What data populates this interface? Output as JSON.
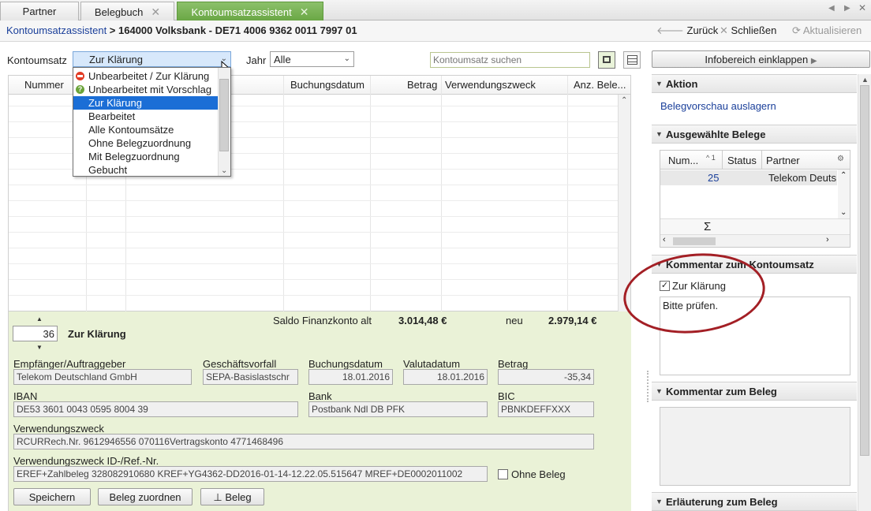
{
  "tabs": [
    {
      "label": "Partner"
    },
    {
      "label": "Belegbuch"
    },
    {
      "label": "Kontoumsatzassistent"
    }
  ],
  "breadcrumb": {
    "link": "Kontoumsatzassistent",
    "rest": " > 164000 Volksbank - DE71 4006 9362 0011 7997 01"
  },
  "toolbar": {
    "back": "Zurück",
    "close": "Schließen",
    "refresh": "Aktualisieren"
  },
  "filters": {
    "kontoumsatz_label": "Kontoumsatz",
    "kontoumsatz_value": "Zur Klärung",
    "jahr_label": "Jahr",
    "jahr_value": "Alle",
    "search_placeholder": "Kontoumsatz suchen",
    "infobereich": "Infobereich einklappen"
  },
  "dropdown_options": [
    "Unbearbeitet / Zur Klärung",
    "Unbearbeitet mit Vorschlag",
    "Zur Klärung",
    "Bearbeitet",
    "Alle Kontoumsätze",
    "Ohne Belegzuordnung",
    "Mit Belegzuordnung",
    "Gebucht"
  ],
  "grid": {
    "columns": [
      "Nummer",
      "Buchungsdatum",
      "Betrag",
      "Verwendungszweck",
      "Anz. Bele..."
    ]
  },
  "detail": {
    "saldo_label": "Saldo Finanzkonto alt",
    "saldo_alt": "3.014,48 €",
    "neu_label": "neu",
    "saldo_neu": "2.979,14 €",
    "number": "36",
    "status": "Zur Klärung",
    "empfaenger_label": "Empfänger/Auftraggeber",
    "empfaenger": "Telekom Deutschland GmbH",
    "geschaeftsvorfall_label": "Geschäftsvorfall",
    "geschaeftsvorfall": "SEPA-Basislastschr",
    "buchungsdatum_label": "Buchungsdatum",
    "buchungsdatum": "18.01.2016",
    "valutadatum_label": "Valutadatum",
    "valutadatum": "18.01.2016",
    "betrag_label": "Betrag",
    "betrag": "-35,34",
    "iban_label": "IBAN",
    "iban": "DE53 3601 0043 0595 8004 39",
    "bank_label": "Bank",
    "bank": "Postbank Ndl DB PFK",
    "bic_label": "BIC",
    "bic": "PBNKDEFFXXX",
    "vz_label": "Verwendungszweck",
    "vz": "RCURRech.Nr. 9612946556 070116Vertragskonto 4771468496",
    "vzid_label": "Verwendungszweck ID-/Ref.-Nr.",
    "vzid": "EREF+Zahlbeleg 328082910680 KREF+YG4362-DD2016-01-14-12.22.05.515647 MREF+DE0002011002",
    "ohne_beleg": "Ohne Beleg",
    "save": "Speichern",
    "assign": "Beleg zuordnen",
    "beleg": "Beleg"
  },
  "right": {
    "aktion_title": "Aktion",
    "belegvorschau": "Belegvorschau auslagern",
    "ausgewaehlte_title": "Ausgewählte Belege",
    "col_num": "Num...",
    "col_sort": "^ 1",
    "col_status": "Status",
    "col_partner": "Partner",
    "row_num": "25",
    "row_partner": "Telekom Deuts",
    "sigma": "Σ",
    "kommentar_kontoumsatz_title": "Kommentar zum Kontoumsatz",
    "zur_klaerung": "Zur Klärung",
    "kommentar_text": "Bitte prüfen.",
    "kommentar_beleg_title": "Kommentar zum Beleg",
    "erlaeuterung_title": "Erläuterung zum Beleg"
  }
}
